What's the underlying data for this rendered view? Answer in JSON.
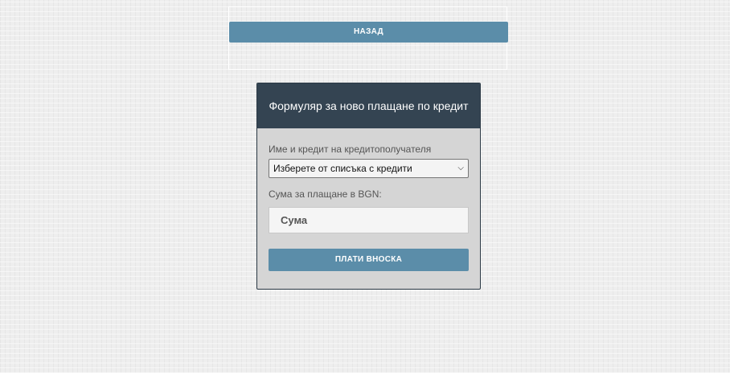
{
  "navigation": {
    "back_label": "НАЗАД"
  },
  "form": {
    "title": "Формуляр за ново плащане по кредит",
    "credit_label": "Име и кредит на кредитополучателя",
    "credit_select_value": "Изберете от списъка с кредити",
    "amount_label": "Сума за плащане в BGN:",
    "amount_placeholder": "Сума",
    "amount_value": "",
    "submit_label": "ПЛАТИ ВНОСКА"
  },
  "colors": {
    "button": "#5b8da9",
    "header": "#344452",
    "panel": "#d5d5d5",
    "background": "#eeeeee"
  },
  "icons": {
    "select_arrow": "chevron-down-icon"
  }
}
